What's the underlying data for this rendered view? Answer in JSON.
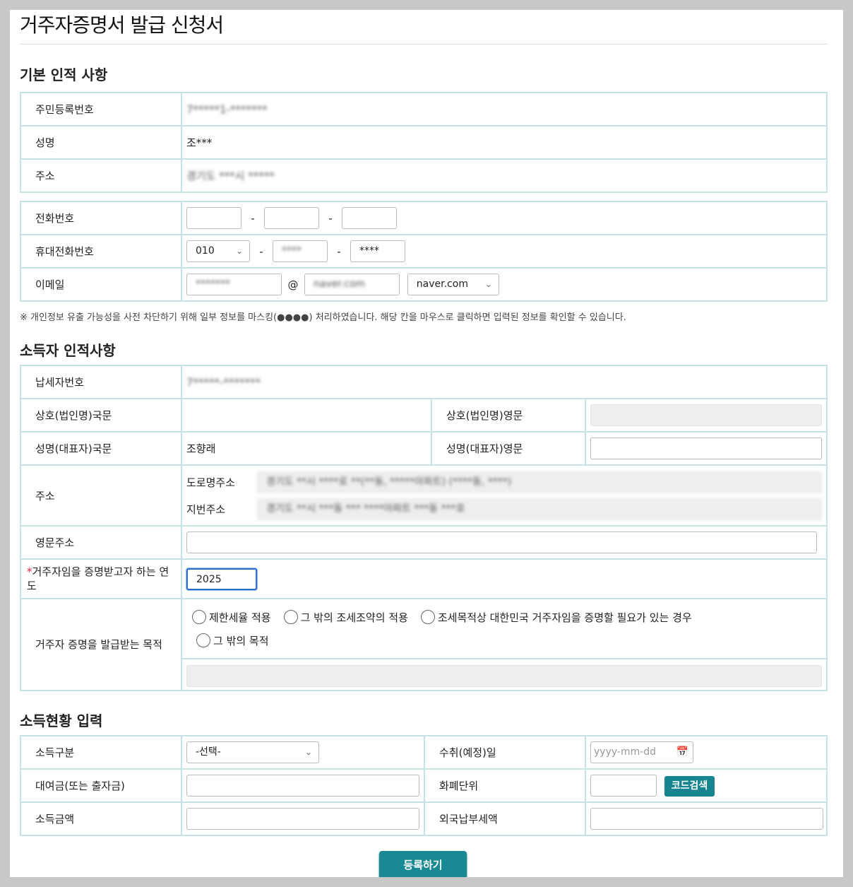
{
  "page_title": "거주자증명서 발급 신청서",
  "sections": {
    "basic": "기본 인적 사항",
    "income_person": "소득자 인적사항",
    "income_status": "소득현황 입력"
  },
  "basic": {
    "rrn_label": "주민등록번호",
    "rrn_value": "7*****1-*******",
    "name_label": "성명",
    "name_value": "조***",
    "addr_label": "주소",
    "addr_value": "경기도 ***시 *****"
  },
  "contact": {
    "phone_label": "전화번호",
    "phone_dash": "-",
    "mobile_label": "휴대전화번호",
    "mobile_prefix": "010",
    "mobile_mid": "****",
    "mobile_last": "****",
    "email_label": "이메일",
    "email_id": "*******",
    "email_at": "@",
    "email_domain": "naver.com",
    "email_domain_select": "naver.com"
  },
  "note": "※ 개인정보 유출 가능성을 사전 차단하기 위해 일부 정보를 마스킹(●●●●) 처리하였습니다. 해당 칸을 마우스로 클릭하면 입력된 정보를 확인할 수 있습니다.",
  "income_person": {
    "taxpayer_label": "납세자번호",
    "taxpayer_value": "7*****-*******",
    "corp_kr_label": "상호(법인명)국문",
    "corp_en_label": "상호(법인명)영문",
    "rep_kr_label": "성명(대표자)국문",
    "rep_kr_value": "조향래",
    "rep_en_label": "성명(대표자)영문",
    "addr_label": "주소",
    "road_label": "도로명주소",
    "road_value": "경기도 **시 ****로 **(**동, *****아파트) (****동, ****)",
    "lot_label": "지번주소",
    "lot_value": "경기도 **시 ***동 *** ****아파트 ***동 ***호",
    "en_addr_label": "영문주소",
    "year_label": "거주자임을 증명받고자 하는 연도",
    "year_required": "*",
    "year_value": "2025",
    "purpose_label": "거주자 증명을 발급받는 목적",
    "purpose_options": [
      "제한세율 적용",
      "그 밖의 조세조약의 적용",
      "조세목적상 대한민국 거주자임을 증명할 필요가 있는 경우",
      "그 밖의 목적"
    ]
  },
  "income_status": {
    "type_label": "소득구분",
    "type_value": "-선택-",
    "recv_date_label": "수취(예정)일",
    "recv_date_placeholder": "yyyy-mm-dd",
    "loan_label": "대여금(또는 출자금)",
    "currency_label": "화폐단위",
    "code_search_button": "코드검색",
    "amount_label": "소득금액",
    "foreign_tax_label": "외국납부세액"
  },
  "submit_label": "등록하기",
  "colors": {
    "accent": "#198a93",
    "border": "#c6e2e4"
  }
}
